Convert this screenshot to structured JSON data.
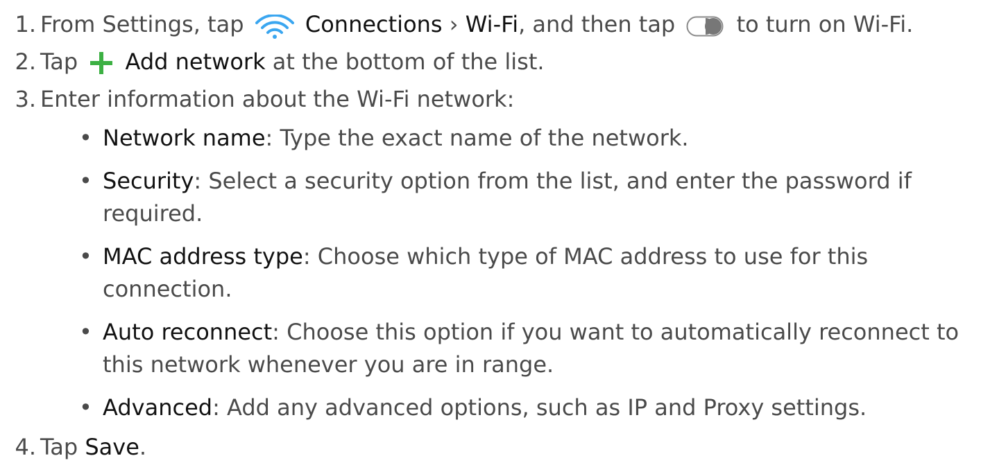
{
  "steps": [
    {
      "number": "1.",
      "pre": "From Settings, tap",
      "connections": "Connections",
      "separator": "›",
      "wifi": "Wi-Fi",
      "mid": ", and then tap",
      "post": "to turn on Wi-Fi."
    },
    {
      "number": "2.",
      "pre": "Tap",
      "add_network": "Add network",
      "post": "at the bottom of the list."
    },
    {
      "number": "3.",
      "text": "Enter information about the Wi-Fi network:"
    },
    {
      "number": "4.",
      "pre": "Tap",
      "save": "Save",
      "post": "."
    }
  ],
  "bullets": [
    {
      "bullet": "•",
      "term": "Network name",
      "text": ": Type the exact name of the network."
    },
    {
      "bullet": "•",
      "term": "Security",
      "text": ": Select a security option from the list, and enter the password if",
      "cont": "required."
    },
    {
      "bullet": "•",
      "term": "MAC address type",
      "text": ": Choose which type of MAC address to use for this",
      "cont": "connection."
    },
    {
      "bullet": "•",
      "term": "Auto reconnect",
      "text": ": Choose this option if you want to automatically reconnect to",
      "cont": "this network whenever you are in range."
    },
    {
      "bullet": "•",
      "term": "Advanced",
      "text": ": Add any advanced options, such as IP and Proxy settings."
    }
  ],
  "icons": {
    "wifi": "wifi-icon",
    "toggle": "toggle-switch-icon",
    "plus": "plus-icon"
  },
  "colors": {
    "body_text": "#4a4a4a",
    "bold_text": "#111111",
    "wifi_blue": "#3aa6f0",
    "plus_green": "#3cb043",
    "toggle_off_border": "#8a8a8a",
    "toggle_knob": "#777777"
  }
}
